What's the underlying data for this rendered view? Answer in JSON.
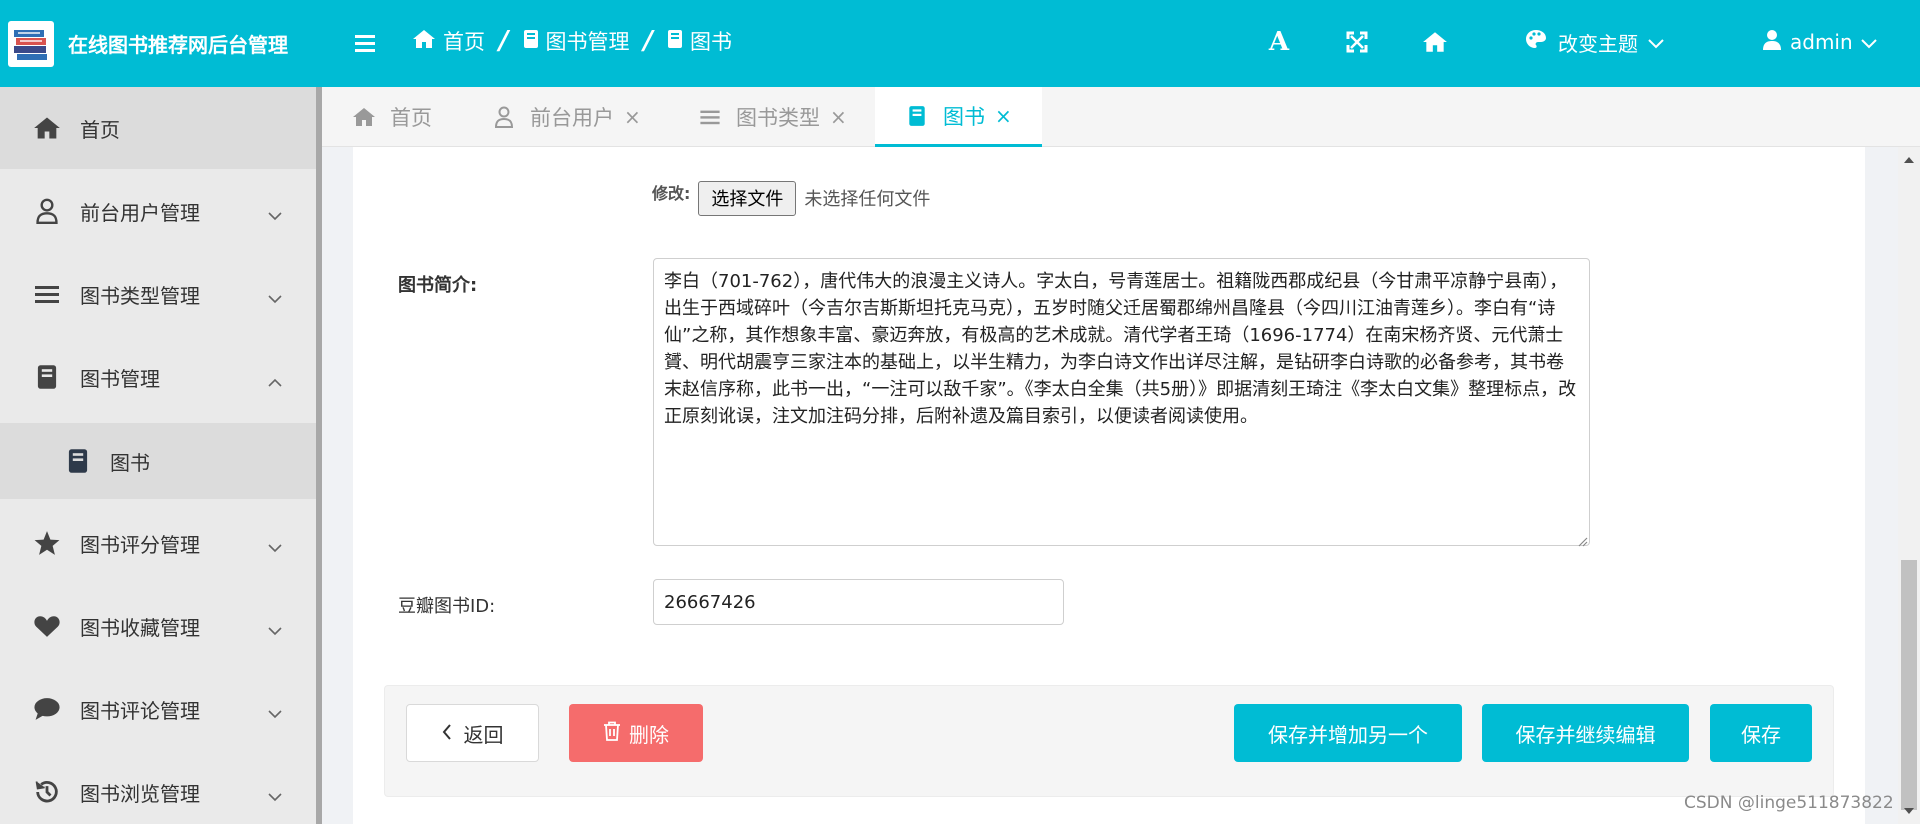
{
  "brand": {
    "title": "在线图书推荐网后台管理"
  },
  "header": {
    "breadcrumb": [
      "首页",
      "图书管理",
      "图书"
    ],
    "breadcrumb_sep": "/",
    "font_tool": "A",
    "theme_label": "改变主题",
    "user_label": "admin"
  },
  "sidebar": {
    "items": [
      {
        "label": "首页",
        "icon": "home-icon"
      },
      {
        "label": "前台用户管理",
        "icon": "user-icon"
      },
      {
        "label": "图书类型管理",
        "icon": "list-icon"
      },
      {
        "label": "图书管理",
        "icon": "book-icon"
      },
      {
        "label": "图书",
        "icon": "book-icon"
      },
      {
        "label": "图书评分管理",
        "icon": "star-icon"
      },
      {
        "label": "图书收藏管理",
        "icon": "heart-icon"
      },
      {
        "label": "图书评论管理",
        "icon": "comment-icon"
      },
      {
        "label": "图书浏览管理",
        "icon": "history-icon"
      }
    ]
  },
  "tabs": [
    {
      "label": "首页",
      "icon": "home-icon"
    },
    {
      "label": "前台用户",
      "icon": "user-icon",
      "close": "×"
    },
    {
      "label": "图书类型",
      "icon": "list-icon",
      "close": "×"
    },
    {
      "label": "图书",
      "icon": "book-icon",
      "close": "×",
      "active": true
    }
  ],
  "form": {
    "modify_label": "修改:",
    "file_button": "选择文件",
    "file_none": "未选择任何文件",
    "intro_label": "图书简介:",
    "intro_value": "李白（701-762），唐代伟大的浪漫主义诗人。字太白，号青莲居士。祖籍陇西郡成纪县（今甘肃平凉静宁县南），出生于西域碎叶（今吉尔吉斯斯坦托克马克），五岁时随父迁居蜀郡绵州昌隆县（今四川江油青莲乡）。李白有“诗仙”之称，其作想象丰富、豪迈奔放，有极高的艺术成就。清代学者王琦（1696-1774）在南宋杨齐贤、元代萧士贇、明代胡震亨三家注本的基础上，以半生精力，为李白诗文作出详尽注解，是钻研李白诗歌的必备参考，其书卷末赵信序称，此书一出，“一注可以敌千家”。《李太白全集（共5册）》即据清刻王琦注《李太白文集》整理标点，改正原刻讹误，注文加注码分排，后附补遗及篇目索引，以便读者阅读使用。",
    "douban_label": "豆瓣图书ID:",
    "douban_value": "26667426"
  },
  "actions": {
    "back": "返回",
    "delete": "删除",
    "save_add": "保存并增加另一个",
    "save_edit": "保存并继续编辑",
    "save": "保存"
  },
  "watermark": "CSDN @linge511873822",
  "colors": {
    "accent": "#00bcd4",
    "danger": "#f56c6c",
    "sidebar_bg": "#eaeaea"
  }
}
